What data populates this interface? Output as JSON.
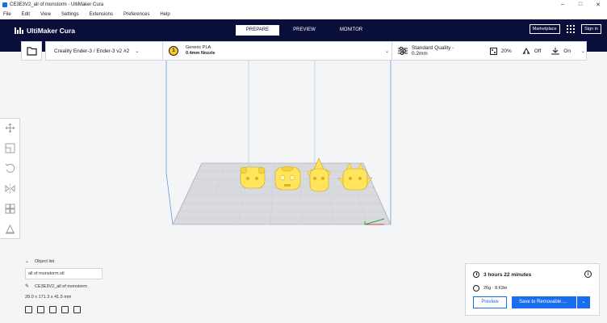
{
  "window": {
    "title": "CE3E3V2_all of monstorm - UltiMaker Cura",
    "minimize": "–",
    "maximize": "□",
    "close": "✕"
  },
  "menu": [
    "File",
    "Edit",
    "View",
    "Settings",
    "Extensions",
    "Preferences",
    "Help"
  ],
  "header": {
    "brand": "UltiMaker Cura",
    "stages": [
      "PREPARE",
      "PREVIEW",
      "MONITOR"
    ],
    "marketplace": "Marketplace",
    "signin": "Sign in"
  },
  "toolbar": {
    "printer": "Creality Ender-3 / Ender-3 v2 #2",
    "extruder_number": "1",
    "material": "Generic PLA",
    "nozzle": "0.4mm Nozzle",
    "profile": "Standard Quality - 0.2mm",
    "infill": "20%",
    "support": "Off",
    "adhesion": "On"
  },
  "objects": {
    "header": "Object list",
    "filter_value": "all of monstorm.stl",
    "name": "CE3E3V2_all of monstorm",
    "dimensions": "28.0 x 171.3 x 41.5 mm"
  },
  "print": {
    "time": "3 hours 22 minutes",
    "material_usage": "26g · 8.63m",
    "preview": "Preview",
    "save": "Save to Removable ..."
  },
  "colors": {
    "header_bg": "#0a0e3b",
    "accent": "#196ef0",
    "model": "#ffe45c"
  },
  "icons": {
    "tools": [
      "move-icon",
      "scale-icon",
      "rotate-icon",
      "mirror-icon",
      "per-model-settings-icon",
      "support-blocker-icon"
    ]
  }
}
